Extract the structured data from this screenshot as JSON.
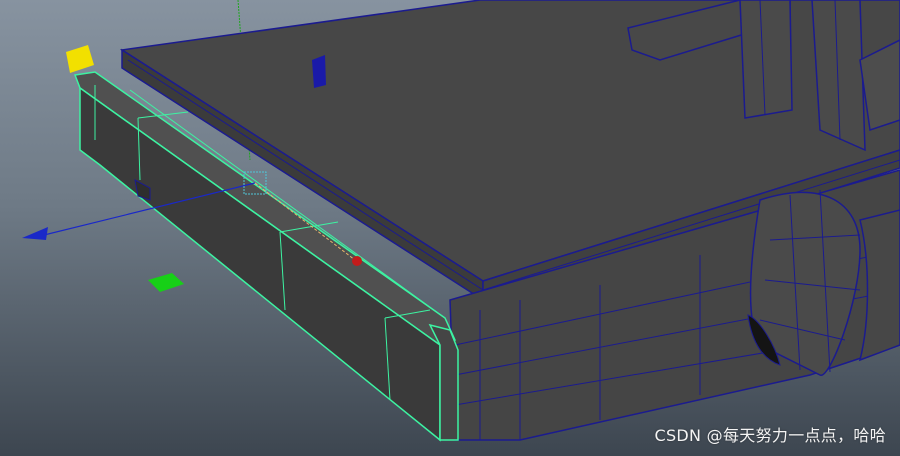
{
  "app": {
    "view": "3D viewport (wireframe on shaded)"
  },
  "colors": {
    "mesh_fill": "#474747",
    "mesh_fill_dark": "#383838",
    "wire_default": "#1b1b8f",
    "wire_selected": "#3df3a2",
    "axis_x": "#1a28c8",
    "axis_y": "#1fa61f",
    "axis_z": "#c21b1b",
    "handle_yellow": "#f2e000",
    "handle_blue": "#1a1aa8",
    "handle_green": "#17d017"
  },
  "icons": {
    "manipulator": "move-tool-manipulator"
  },
  "watermark": {
    "text": "CSDN @每天努力一点点，哈哈"
  }
}
